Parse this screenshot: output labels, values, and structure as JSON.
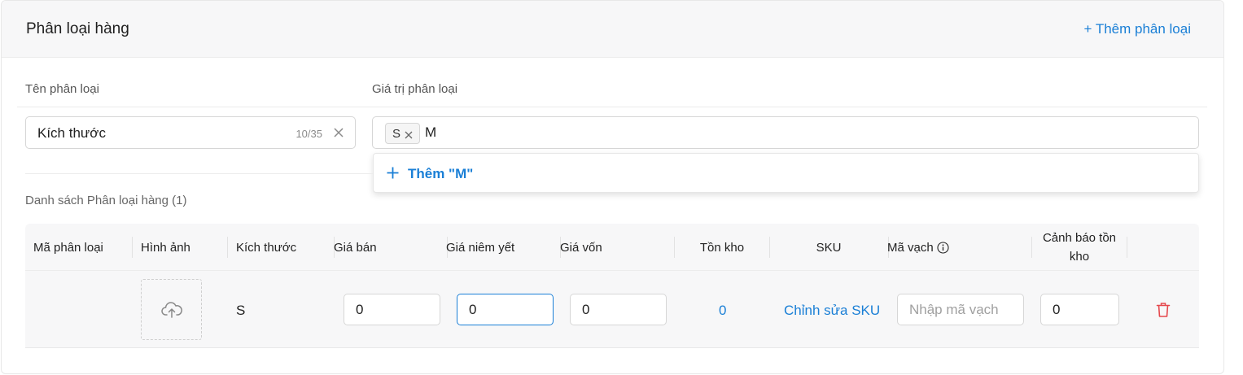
{
  "header": {
    "title": "Phân loại hàng",
    "add_variant_label": "+ Thêm phân loại"
  },
  "form": {
    "name_label": "Tên phân loại",
    "values_label": "Giá trị phân loại",
    "name_value": "Kích thước",
    "name_count": "10/35",
    "tags": [
      "S"
    ],
    "typed_value": "M",
    "dropdown_add_label": "Thêm \"M\""
  },
  "variant_list": {
    "title": "Danh sách Phân loại hàng (1)",
    "columns": [
      "Mã phân loại",
      "Hình ảnh",
      "Kích thước",
      "Giá bán",
      "Giá niêm yết",
      "Giá vốn",
      "Tồn kho",
      "SKU",
      "Mã vạch",
      "Cảnh báo tồn kho"
    ],
    "rows": [
      {
        "code": "",
        "size": "S",
        "sale_price": "0",
        "list_price": "0",
        "cost_price": "0",
        "stock": "0",
        "sku_link": "Chỉnh sửa SKU",
        "barcode_placeholder": "Nhập mã vạch",
        "stock_alert": "0"
      }
    ]
  },
  "icons": {
    "clear": "close-icon",
    "tag_remove": "close-icon",
    "add": "plus-icon",
    "upload": "cloud-upload-icon",
    "info": "info-icon",
    "delete": "trash-icon"
  },
  "colors": {
    "accent": "#1a7fd6",
    "danger": "#e5484d",
    "header_bg": "#f7f7f8"
  }
}
